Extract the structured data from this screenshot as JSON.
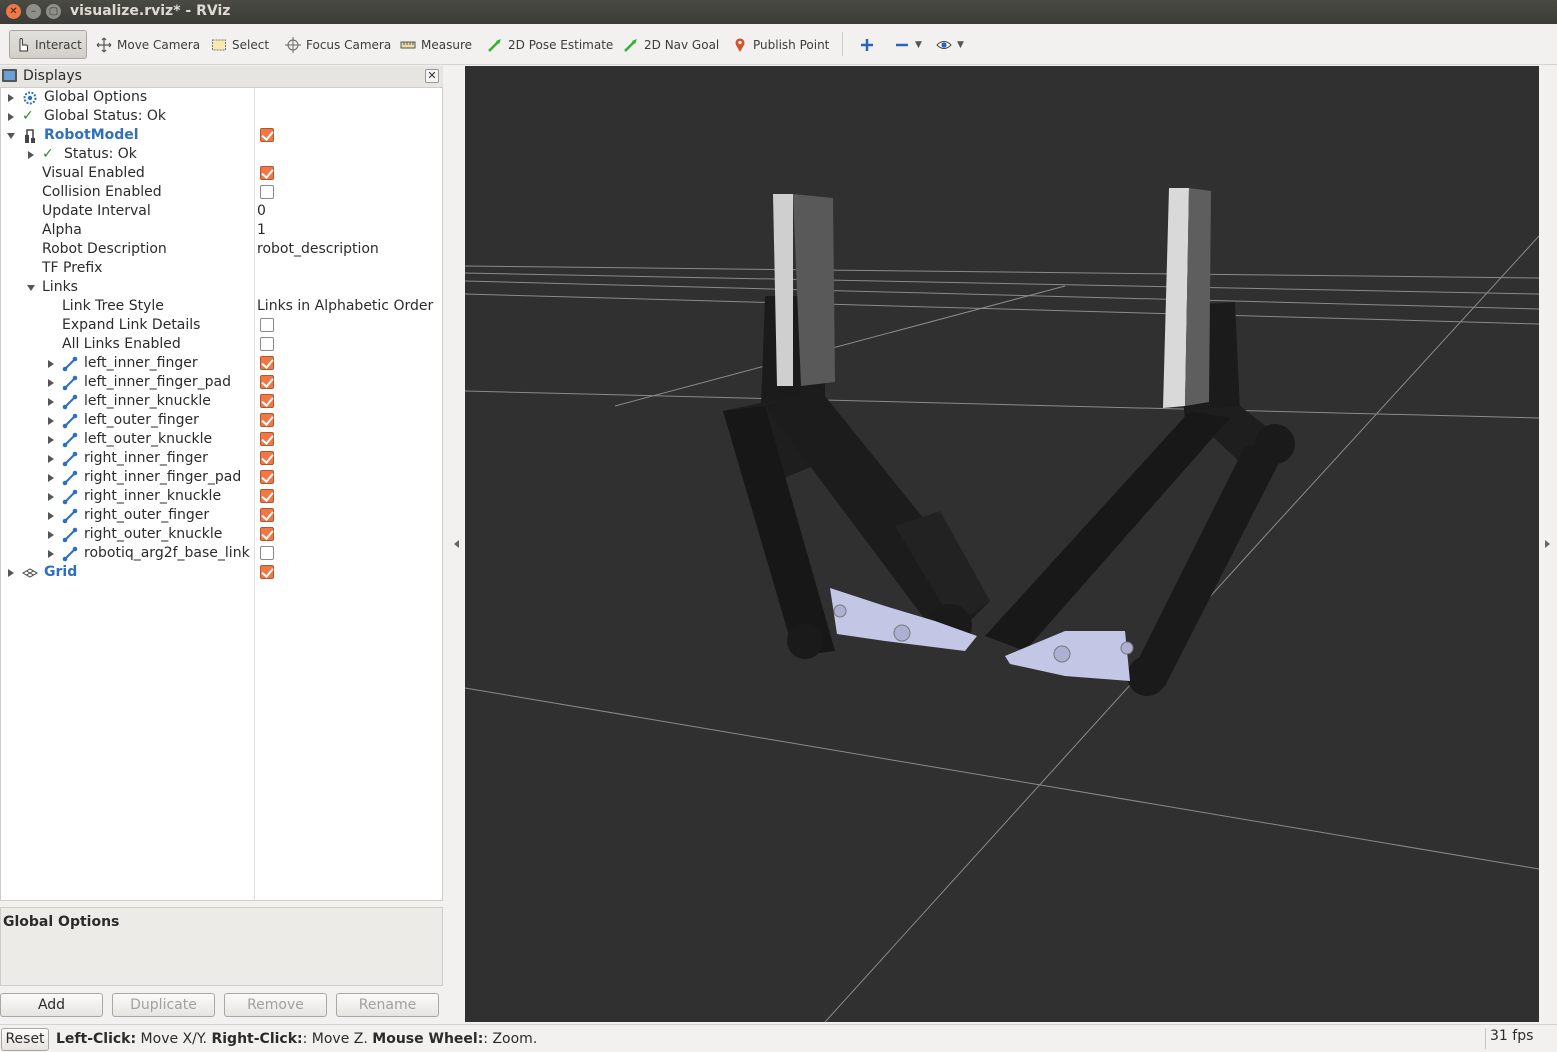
{
  "window": {
    "title": "visualize.rviz* - RViz"
  },
  "toolbar": {
    "tools": [
      {
        "id": "interact",
        "label": "Interact",
        "icon": "hand-pointer-icon"
      },
      {
        "id": "move-camera",
        "label": "Move Camera",
        "icon": "move-arrows-icon"
      },
      {
        "id": "select",
        "label": "Select",
        "icon": "select-rect-icon"
      },
      {
        "id": "focus-camera",
        "label": "Focus Camera",
        "icon": "crosshair-icon"
      },
      {
        "id": "measure",
        "label": "Measure",
        "icon": "ruler-icon"
      },
      {
        "id": "pose-estimate",
        "label": "2D Pose Estimate",
        "icon": "green-arrow-icon"
      },
      {
        "id": "nav-goal",
        "label": "2D Nav Goal",
        "icon": "green-arrow-icon"
      },
      {
        "id": "publish-point",
        "label": "Publish Point",
        "icon": "map-pin-icon"
      }
    ]
  },
  "displays": {
    "title": "Displays",
    "rows": [
      {
        "name": "Global Options",
        "value": ""
      },
      {
        "name": "Global Status: Ok",
        "value": ""
      },
      {
        "name": "RobotModel",
        "value": ""
      },
      {
        "name": "Status: Ok",
        "value": ""
      },
      {
        "name": "Visual Enabled",
        "value": ""
      },
      {
        "name": "Collision Enabled",
        "value": ""
      },
      {
        "name": "Update Interval",
        "value": "0"
      },
      {
        "name": "Alpha",
        "value": "1"
      },
      {
        "name": "Robot Description",
        "value": "robot_description"
      },
      {
        "name": "TF Prefix",
        "value": ""
      },
      {
        "name": "Links",
        "value": ""
      },
      {
        "name": "Link Tree Style",
        "value": "Links in Alphabetic Order"
      },
      {
        "name": "Expand Link Details",
        "value": ""
      },
      {
        "name": "All Links Enabled",
        "value": ""
      },
      {
        "name": "left_inner_finger",
        "value": ""
      },
      {
        "name": "left_inner_finger_pad",
        "value": ""
      },
      {
        "name": "left_inner_knuckle",
        "value": ""
      },
      {
        "name": "left_outer_finger",
        "value": ""
      },
      {
        "name": "left_outer_knuckle",
        "value": ""
      },
      {
        "name": "right_inner_finger",
        "value": ""
      },
      {
        "name": "right_inner_finger_pad",
        "value": ""
      },
      {
        "name": "right_inner_knuckle",
        "value": ""
      },
      {
        "name": "right_outer_finger",
        "value": ""
      },
      {
        "name": "right_outer_knuckle",
        "value": ""
      },
      {
        "name": "robotiq_arg2f_base_link",
        "value": ""
      },
      {
        "name": "Grid",
        "value": ""
      }
    ],
    "checks": {
      "robotmodel": true,
      "visual_enabled": true,
      "collision_enabled": false,
      "expand_link_details": false,
      "all_links_enabled": false,
      "left_inner_finger": true,
      "left_inner_finger_pad": true,
      "left_inner_knuckle": true,
      "left_outer_finger": true,
      "left_outer_knuckle": true,
      "right_inner_finger": true,
      "right_inner_finger_pad": true,
      "right_inner_knuckle": true,
      "right_outer_finger": true,
      "right_outer_knuckle": true,
      "robotiq_arg2f_base_link": false,
      "grid": true
    },
    "description_title": "Global Options",
    "buttons": {
      "add": "Add",
      "duplicate": "Duplicate",
      "remove": "Remove",
      "rename": "Rename"
    }
  },
  "statusbar": {
    "reset": "Reset",
    "help": [
      {
        "key": "Left-Click:",
        "text": " Move X/Y. "
      },
      {
        "key": "Right-Click:",
        "text": ": Move Z. "
      },
      {
        "key": "Mouse Wheel:",
        "text": ": Zoom."
      }
    ],
    "fps": "31 fps"
  },
  "colors": {
    "accent_orange": "#f07746",
    "tree_blue": "#2e6fc2",
    "viewport_bg": "#303030"
  }
}
